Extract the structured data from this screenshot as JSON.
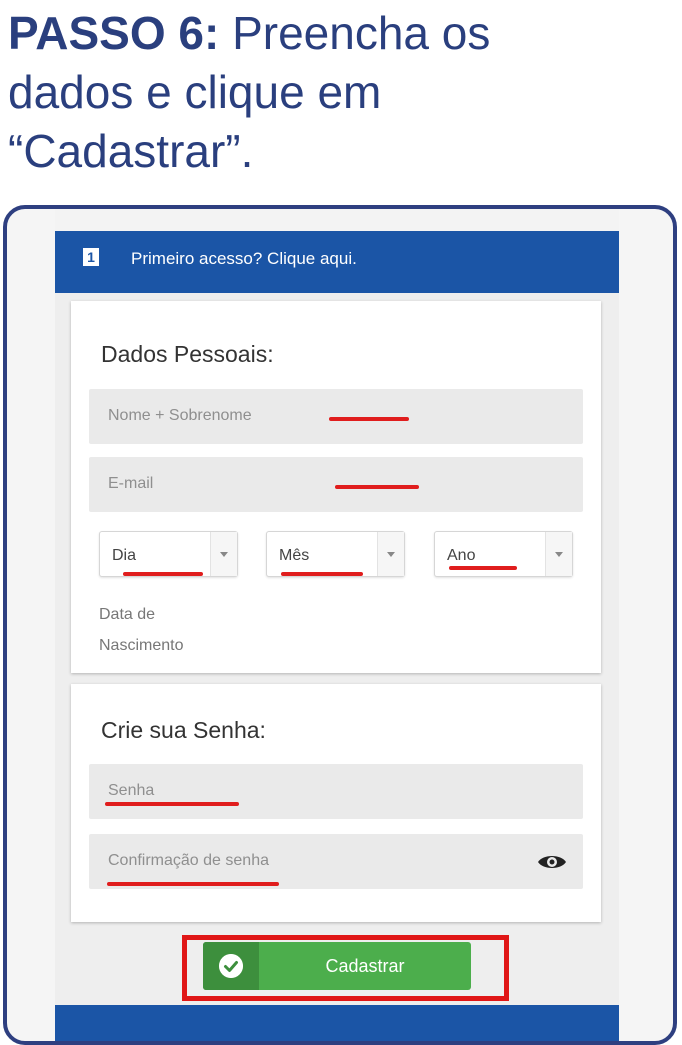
{
  "heading": {
    "step": "PASSO 6:",
    "line1_rest": "Preencha os",
    "line2": "dados e clique em",
    "line3": "“Cadastrar”."
  },
  "banner": {
    "badge": "1",
    "text": "Primeiro acesso? Clique aqui."
  },
  "personal": {
    "title": "Dados Pessoais:",
    "name_placeholder": "Nome + Sobrenome",
    "email_placeholder": "E-mail",
    "day": "Dia",
    "month": "Mês",
    "year": "Ano",
    "dob_line1": "Data de",
    "dob_line2": "Nascimento"
  },
  "password": {
    "title": "Crie sua Senha:",
    "password_placeholder": "Senha",
    "confirm_placeholder": "Confirmação de senha",
    "eye_icon": "eye-icon"
  },
  "submit": {
    "label": "Cadastrar",
    "icon": "check-circle-icon"
  },
  "colors": {
    "heading": "#2a3f7e",
    "banner": "#1b55a6",
    "highlight": "#e01d1d",
    "button": "#4cae4c"
  }
}
